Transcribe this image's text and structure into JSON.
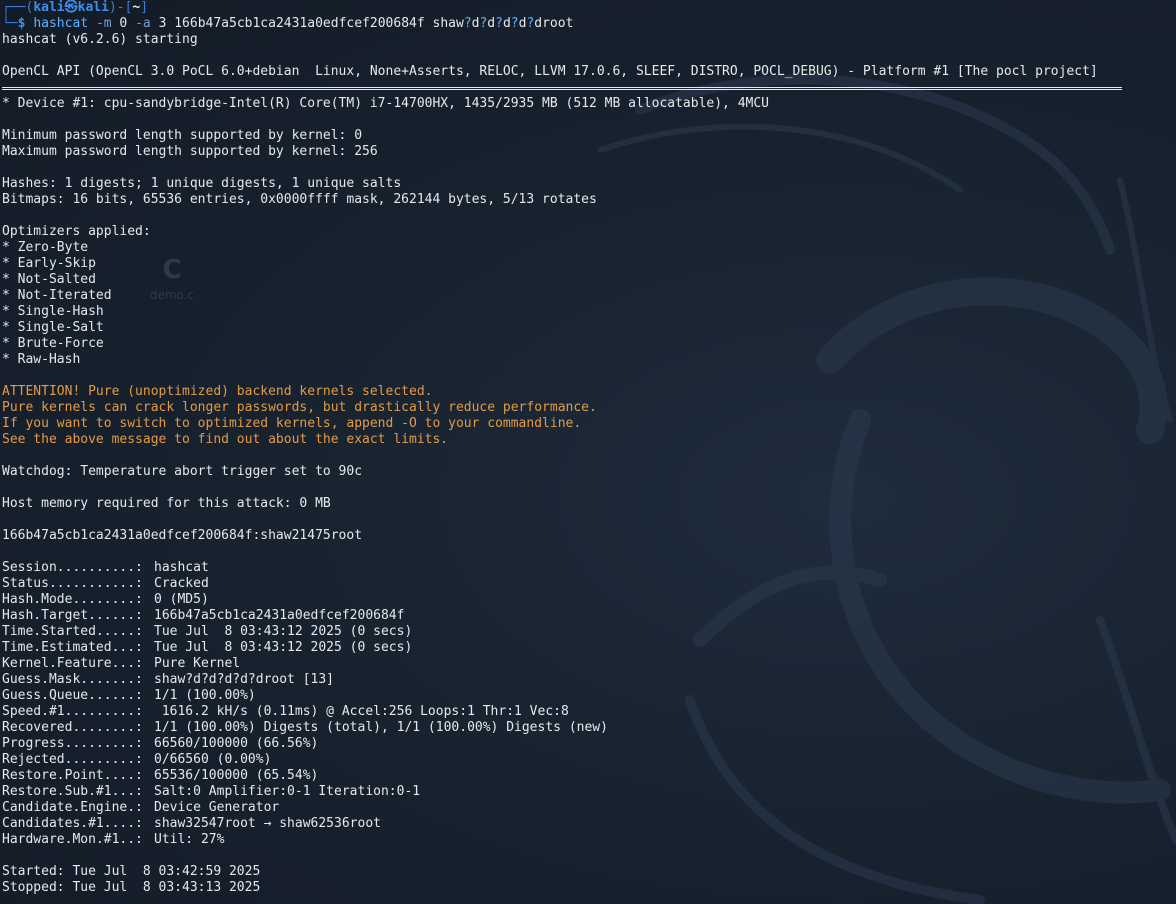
{
  "colors": {
    "background": "#16202c",
    "text": "#e6e8eb",
    "prompt_blue": "#3d8ef0",
    "command_blue": "#5db0ff",
    "warning_orange": "#e39a45"
  },
  "prompt": {
    "frame_top": "┌──(",
    "user": "kali㉿kali",
    "mid": ")-[",
    "dir": "~",
    "end": "]",
    "frame_bottom": "└─",
    "dollar": "$"
  },
  "command": {
    "exe": "hashcat",
    "flag_mode": "-m",
    "mode_value": "0",
    "flag_attack": "-a",
    "attack_value": "3",
    "hash": "166b47a5cb1ca2431a0edfcef200684f",
    "mask_parts": [
      "shaw",
      "?",
      "d",
      "?",
      "d",
      "?",
      "d",
      "?",
      "d",
      "?",
      "d",
      "root"
    ]
  },
  "startup": "hashcat (v6.2.6) starting",
  "opencl": "OpenCL API (OpenCL 3.0 PoCL 6.0+debian  Linux, None+Asserts, RELOC, LLVM 17.0.6, SLEEF, DISTRO, POCL_DEBUG) - Platform #1 [The pocl project]",
  "device": "* Device #1: cpu-sandybridge-Intel(R) Core(TM) i7-14700HX, 1435/2935 MB (512 MB allocatable), 4MCU",
  "kernel_min": "Minimum password length supported by kernel: 0",
  "kernel_max": "Maximum password length supported by kernel: 256",
  "hashes": "Hashes: 1 digests; 1 unique digests, 1 unique salts",
  "bitmaps": "Bitmaps: 16 bits, 65536 entries, 0x0000ffff mask, 262144 bytes, 5/13 rotates",
  "optimizers_header": "Optimizers applied:",
  "optimizers": [
    "* Zero-Byte",
    "* Early-Skip",
    "* Not-Salted",
    "* Not-Iterated",
    "* Single-Hash",
    "* Single-Salt",
    "* Brute-Force",
    "* Raw-Hash"
  ],
  "attention": [
    "ATTENTION! Pure (unoptimized) backend kernels selected.",
    "Pure kernels can crack longer passwords, but drastically reduce performance.",
    "If you want to switch to optimized kernels, append -O to your commandline.",
    "See the above message to find out about the exact limits."
  ],
  "watchdog": "Watchdog: Temperature abort trigger set to 90c",
  "host_memory": "Host memory required for this attack: 0 MB",
  "cracked_result": "166b47a5cb1ca2431a0edfcef200684f:shaw21475root",
  "status": [
    {
      "key": "Session..........:",
      "value": "hashcat"
    },
    {
      "key": "Status...........:",
      "value": "Cracked"
    },
    {
      "key": "Hash.Mode........:",
      "value": "0 (MD5)"
    },
    {
      "key": "Hash.Target......:",
      "value": "166b47a5cb1ca2431a0edfcef200684f"
    },
    {
      "key": "Time.Started.....:",
      "value": "Tue Jul  8 03:43:12 2025 (0 secs)"
    },
    {
      "key": "Time.Estimated...:",
      "value": "Tue Jul  8 03:43:12 2025 (0 secs)"
    },
    {
      "key": "Kernel.Feature...:",
      "value": "Pure Kernel"
    },
    {
      "key": "Guess.Mask.......:",
      "value": "shaw?d?d?d?d?droot [13]"
    },
    {
      "key": "Guess.Queue......:",
      "value": "1/1 (100.00%)"
    },
    {
      "key": "Speed.#1.........:",
      "value": " 1616.2 kH/s (0.11ms) @ Accel:256 Loops:1 Thr:1 Vec:8"
    },
    {
      "key": "Recovered........:",
      "value": "1/1 (100.00%) Digests (total), 1/1 (100.00%) Digests (new)"
    },
    {
      "key": "Progress.........:",
      "value": "66560/100000 (66.56%)"
    },
    {
      "key": "Rejected.........:",
      "value": "0/66560 (0.00%)"
    },
    {
      "key": "Restore.Point....:",
      "value": "65536/100000 (65.54%)"
    },
    {
      "key": "Restore.Sub.#1...:",
      "value": "Salt:0 Amplifier:0-1 Iteration:0-1"
    },
    {
      "key": "Candidate.Engine.:",
      "value": "Device Generator"
    },
    {
      "key": "Candidates.#1....:",
      "value": "shaw32547root → shaw62536root"
    },
    {
      "key": "Hardware.Mon.#1..:",
      "value": "Util: 27%"
    }
  ],
  "started": "Started: Tue Jul  8 03:42:59 2025",
  "stopped": "Stopped: Tue Jul  8 03:43:13 2025",
  "desktop_ghost": {
    "file_label": "demo.c",
    "file_glyph": "C"
  }
}
